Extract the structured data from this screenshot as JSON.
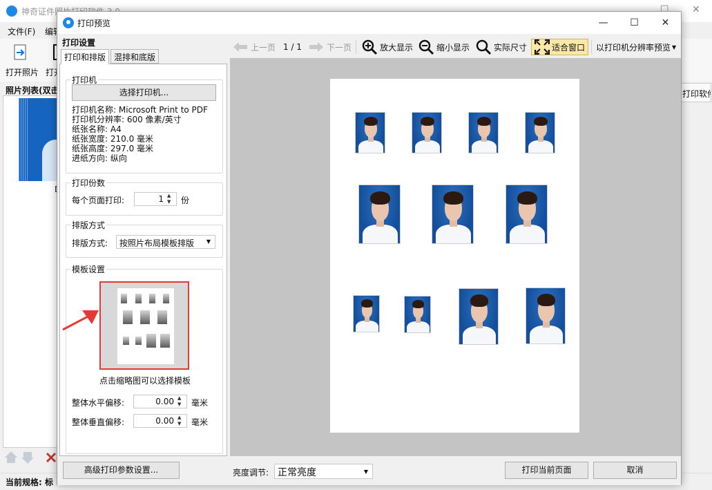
{
  "background_app": {
    "title": "神奇证件照片打印软件 3.0",
    "menu": [
      "文件(F)",
      "编辑"
    ],
    "toolbar": [
      "打开照片",
      "打开"
    ],
    "list_header": "照片列表(双击",
    "thumb_label": "D",
    "right_button": "打印软件",
    "status": "当前规格: 标"
  },
  "dialog": {
    "title": "打印预览",
    "window_controls": {
      "minimize": "—",
      "maximize": "☐",
      "close": "✕"
    },
    "left_header": "打印设置",
    "tabs": [
      "打印和排版",
      "混排和底版"
    ],
    "printer": {
      "legend": "打印机",
      "select_button": "选择打印机...",
      "name": "打印机名称: Microsoft Print to PDF",
      "resolution": "打印机分辨率: 600 像素/英寸",
      "paper_name": "纸张名称: A4",
      "paper_width": "纸张宽度: 210.0 毫米",
      "paper_height": "纸张高度: 297.0 毫米",
      "feed_direction": "进纸方向: 纵向"
    },
    "copies": {
      "legend": "打印份数",
      "label": "每个页面打印:",
      "value": "1",
      "unit": "份"
    },
    "layout": {
      "legend": "排版方式",
      "label": "排版方式:",
      "value": "按照片布局模板排版"
    },
    "template": {
      "legend": "模板设置",
      "hint": "点击缩略图可以选择模板",
      "h_offset_label": "整体水平偏移:",
      "h_offset_value": "0.00",
      "v_offset_label": "整体垂直偏移:",
      "v_offset_value": "0.00",
      "unit": "毫米"
    },
    "preview_toolbar": {
      "prev_page": "上一页",
      "page_indicator": "1 / 1",
      "next_page": "下一页",
      "zoom_in": "放大显示",
      "zoom_out": "缩小显示",
      "actual_size": "实际尺寸",
      "fit_window": "适合窗口",
      "printer_res_preview": "以打印机分辨率预览"
    },
    "bottom": {
      "advanced_button": "高级打印参数设置...",
      "brightness_label": "亮度调节:",
      "brightness_value": "正常亮度",
      "print_button": "打印当前页面",
      "cancel_button": "取消"
    }
  }
}
